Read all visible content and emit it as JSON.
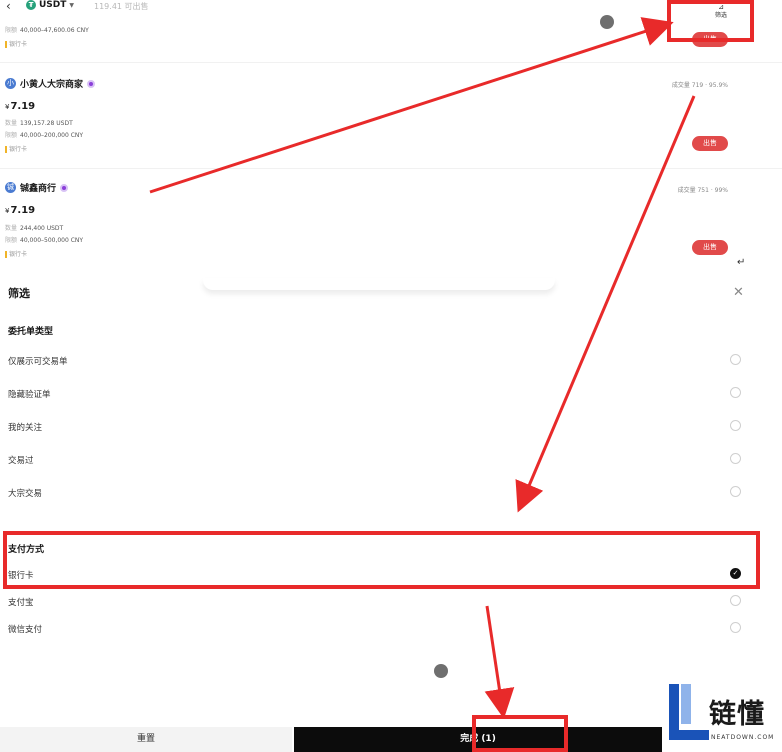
{
  "topbar": {
    "coin": "USDT",
    "sellable": "119.41 可出售",
    "filter_label": "筛选"
  },
  "first_row": {
    "limit_key": "限额",
    "limit": "40,000–47,600.06 CNY",
    "payment": "银行卡",
    "sell_label": "出售"
  },
  "merchants": [
    {
      "avatar": "小",
      "name": "小黄人大宗商家",
      "stats": "成交量 719  ·  95.9%",
      "currency": "¥",
      "price": "7.19",
      "qty_key": "数量",
      "qty": "139,157.28 USDT",
      "limit_key": "限额",
      "limit": "40,000–200,000 CNY",
      "payment": "银行卡",
      "sell_label": "出售"
    },
    {
      "avatar": "铖",
      "name": "铖鑫商行",
      "stats": "成交量 751  ·  99%",
      "currency": "¥",
      "price": "7.19",
      "qty_key": "数量",
      "qty": "244,400 USDT",
      "limit_key": "限额",
      "limit": "40,000–500,000 CNY",
      "payment": "银行卡",
      "sell_label": "出售"
    }
  ],
  "sheet": {
    "title": "筛选",
    "order_type": {
      "title": "委托单类型",
      "options": [
        "仅展示可交易单",
        "隐藏验证单",
        "我的关注",
        "交易过",
        "大宗交易"
      ]
    },
    "payment": {
      "title": "支付方式",
      "options": [
        "银行卡",
        "支付宝",
        "微信支付"
      ],
      "selected": "银行卡"
    },
    "reset_label": "重置",
    "done_label": "完成 (1)"
  },
  "watermark": {
    "cn": "链懂",
    "en": "NEATDOWN.COM"
  },
  "colors": {
    "sell": "#e14a4a",
    "annotation": "#e82a2a",
    "done": "#0c0c0c",
    "tether": "#26a17b",
    "watermark_blue": "#1a53b8"
  }
}
